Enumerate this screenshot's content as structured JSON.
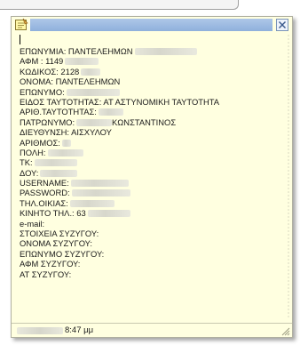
{
  "note": {
    "icon": "sticky-note-icon",
    "close_icon": "close-icon",
    "lines": [
      {
        "text": "ΕΠΩΝΥΜΙΑ: ΠΑΝΤΕΛΕΗΜΩΝ",
        "redacted": true
      },
      {
        "text": "ΑΦΜ : 1149",
        "redacted": true
      },
      {
        "text": "ΚΩΔΙΚΟΣ: 2128",
        "redacted": true
      },
      {
        "text": "ΟΝΟΜΑ: ΠΑΝΤΕΛΕΗΜΩΝ",
        "redacted": false
      },
      {
        "text": "ΕΠΩΝΥΜΟ:",
        "redacted": true
      },
      {
        "text": "ΕΙΔΟΣ ΤΑΥΤΟΤΗΤΑΣ: ΑΤ ΑΣΤΥΝΟΜΙΚΗ ΤΑΥΤΟΤΗΤΑ",
        "redacted": false
      },
      {
        "text": "ΑΡΙΘ.ΤΑΥΤΟΤΗΤΑΣ:",
        "redacted": true
      },
      {
        "text": "ΠΑΤΡΩΝΥΜΟ:",
        "redacted": true,
        "suffix": "ΚΩΝΣΤΑΝΤΙΝΟΣ"
      },
      {
        "text": "ΔΙΕΥΘΥΝΣΗ: ΑΙΣΧΥΛΟΥ",
        "redacted": false
      },
      {
        "text": "ΑΡΙΘΜΟΣ:",
        "redacted": true
      },
      {
        "text": "ΠΟΛΗ:",
        "redacted": true
      },
      {
        "text": "ΤΚ:",
        "redacted": true
      },
      {
        "text": "ΔΟΥ:",
        "redacted": true
      },
      {
        "text": "USERNAME:",
        "redacted": true
      },
      {
        "text": "PASSWORD:",
        "redacted": true
      },
      {
        "text": "ΤΗΛ.ΟΙΚΙΑΣ:",
        "redacted": true
      },
      {
        "text": "ΚΙΝΗΤΟ ΤΗΛ.: 63",
        "redacted": true
      },
      {
        "text": "e-mail:",
        "redacted": false
      },
      {
        "text": "ΣΤΟΙΧΕΙΑ ΣΥΖΥΓΟΥ:",
        "redacted": false
      },
      {
        "text": "ΟΝΟΜΑ ΣΥΖΥΓΟΥ:",
        "redacted": false
      },
      {
        "text": "ΕΠΩΝΥΜΟ ΣΥΖΥΓΟΥ:",
        "redacted": false
      },
      {
        "text": "ΑΦΜ ΣΥΖΥΓΟΥ:",
        "redacted": false
      },
      {
        "text": "ΑΤ ΣΥΖΥΓΟΥ:",
        "redacted": false
      }
    ],
    "status_time": "8:47 μμ",
    "colors": {
      "background": "#ffffe0",
      "title_accent": "#9fbbe2"
    }
  }
}
